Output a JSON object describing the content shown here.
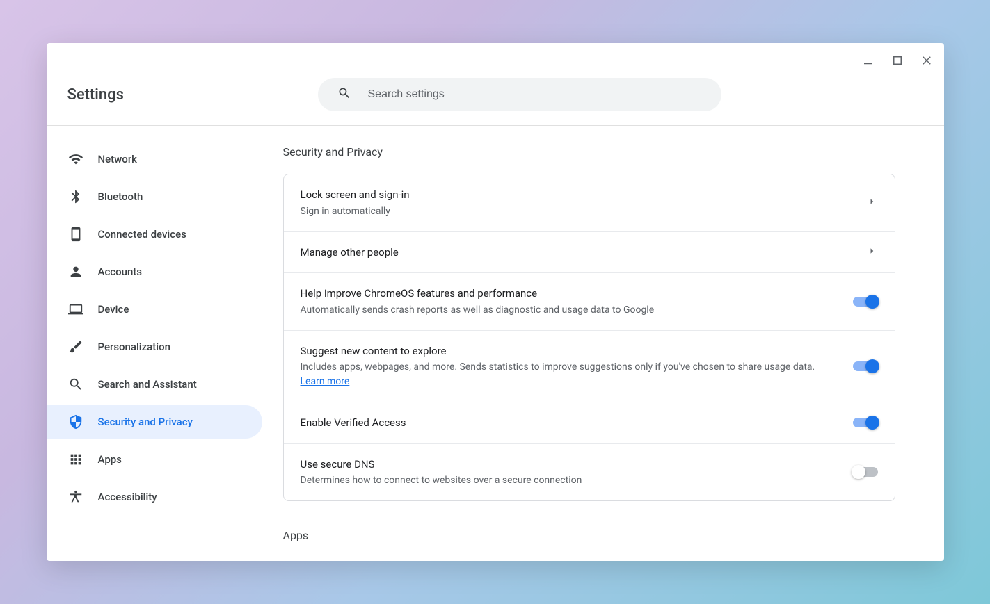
{
  "window": {
    "title": "Settings",
    "search_placeholder": "Search settings"
  },
  "sidebar": {
    "items": [
      {
        "id": "network",
        "label": "Network",
        "icon": "wifi",
        "active": false
      },
      {
        "id": "bluetooth",
        "label": "Bluetooth",
        "icon": "bluetooth",
        "active": false
      },
      {
        "id": "connected-devices",
        "label": "Connected devices",
        "icon": "phone",
        "active": false
      },
      {
        "id": "accounts",
        "label": "Accounts",
        "icon": "person",
        "active": false
      },
      {
        "id": "device",
        "label": "Device",
        "icon": "laptop",
        "active": false
      },
      {
        "id": "personalization",
        "label": "Personalization",
        "icon": "brush",
        "active": false
      },
      {
        "id": "search-assistant",
        "label": "Search and Assistant",
        "icon": "search",
        "active": false
      },
      {
        "id": "security-privacy",
        "label": "Security and Privacy",
        "icon": "shield",
        "active": true
      },
      {
        "id": "apps",
        "label": "Apps",
        "icon": "apps",
        "active": false
      },
      {
        "id": "accessibility",
        "label": "Accessibility",
        "icon": "accessibility",
        "active": false
      }
    ]
  },
  "section": {
    "title": "Security and Privacy",
    "next_section_title": "Apps",
    "rows": [
      {
        "id": "lock-screen",
        "title": "Lock screen and sign-in",
        "desc": "Sign in automatically",
        "trailing": "chevron"
      },
      {
        "id": "manage-people",
        "title": "Manage other people",
        "desc": null,
        "trailing": "chevron"
      },
      {
        "id": "help-improve",
        "title": "Help improve ChromeOS features and performance",
        "desc": "Automatically sends crash reports as well as diagnostic and usage data to Google",
        "trailing": "toggle",
        "toggle_on": true
      },
      {
        "id": "suggest-content",
        "title": "Suggest new content to explore",
        "desc": "Includes apps, webpages, and more. Sends statistics to improve suggestions only if you've chosen to share usage data. ",
        "link_text": "Learn more",
        "trailing": "toggle",
        "toggle_on": true
      },
      {
        "id": "verified-access",
        "title": "Enable Verified Access",
        "desc": null,
        "trailing": "toggle",
        "toggle_on": true
      },
      {
        "id": "secure-dns",
        "title": "Use secure DNS",
        "desc": "Determines how to connect to websites over a secure connection",
        "trailing": "toggle",
        "toggle_on": false
      }
    ]
  }
}
